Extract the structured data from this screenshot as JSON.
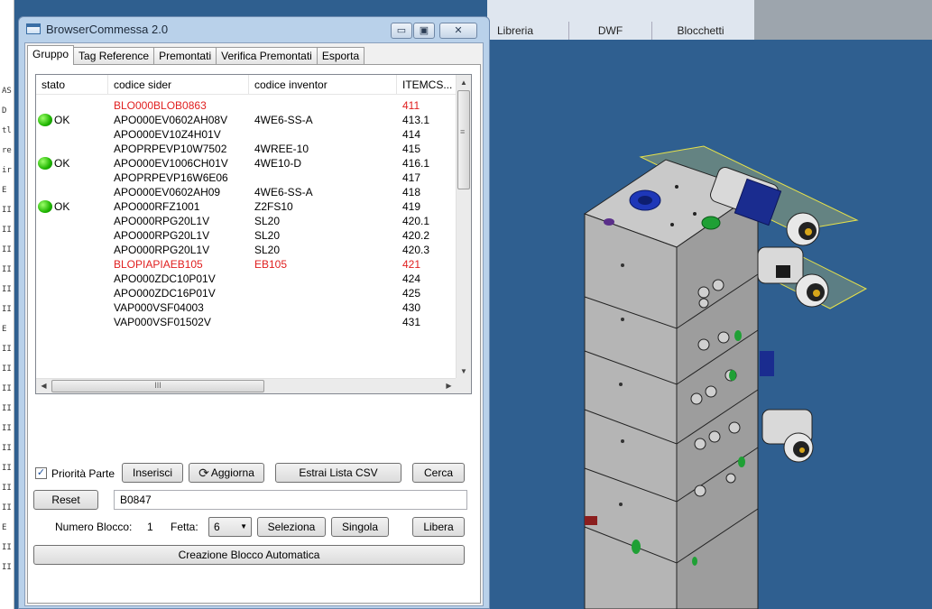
{
  "host": {
    "tabs": [
      "Libreria",
      "DWF",
      "Blocchetti"
    ]
  },
  "left_strip_marks": [
    "AS",
    "D",
    "tl",
    "re",
    "ir",
    "E",
    "II",
    "II",
    "II",
    "II",
    "II",
    "II",
    "E",
    "II",
    "II",
    "II",
    "II",
    "II",
    "II",
    "II",
    "II",
    "II",
    "E",
    "II",
    "II"
  ],
  "window": {
    "title": "BrowserCommessa 2.0",
    "min_glyph": "▭",
    "max_glyph": "▣",
    "close_glyph": "✕",
    "tabs": [
      "Gruppo",
      "Tag Reference",
      "Premontati",
      "Verifica Premontati",
      "Esporta"
    ],
    "active_tab": "Gruppo"
  },
  "list": {
    "columns": [
      "stato",
      "codice sider",
      "codice inventor",
      "ITEMCS..."
    ],
    "rows": [
      {
        "stato": "",
        "sider": "BLO000BLOB0863",
        "inventor": "",
        "item": "411",
        "red": true
      },
      {
        "stato": "OK",
        "sider": "APO000EV0602AH08V",
        "inventor": "4WE6-SS-A",
        "item": "413.1",
        "red": false
      },
      {
        "stato": "",
        "sider": "APO000EV10Z4H01V",
        "inventor": "",
        "item": "414",
        "red": false
      },
      {
        "stato": "",
        "sider": "APOPRPEVP10W7502",
        "inventor": "4WREE-10",
        "item": "415",
        "red": false
      },
      {
        "stato": "OK",
        "sider": "APO000EV1006CH01V",
        "inventor": "4WE10-D",
        "item": "416.1",
        "red": false
      },
      {
        "stato": "",
        "sider": "APOPRPEVP16W6E06",
        "inventor": "",
        "item": "417",
        "red": false
      },
      {
        "stato": "",
        "sider": "APO000EV0602AH09",
        "inventor": "4WE6-SS-A",
        "item": "418",
        "red": false
      },
      {
        "stato": "OK",
        "sider": "APO000RFZ1001",
        "inventor": "Z2FS10",
        "item": "419",
        "red": false
      },
      {
        "stato": "",
        "sider": "APO000RPG20L1V",
        "inventor": "SL20",
        "item": "420.1",
        "red": false
      },
      {
        "stato": "",
        "sider": "APO000RPG20L1V",
        "inventor": "SL20",
        "item": "420.2",
        "red": false
      },
      {
        "stato": "",
        "sider": "APO000RPG20L1V",
        "inventor": "SL20",
        "item": "420.3",
        "red": false
      },
      {
        "stato": "",
        "sider": "BLOPIAPIAEB105",
        "inventor": "EB105",
        "item": "421",
        "red": true
      },
      {
        "stato": "",
        "sider": "APO000ZDC10P01V",
        "inventor": "",
        "item": "424",
        "red": false
      },
      {
        "stato": "",
        "sider": "APO000ZDC16P01V",
        "inventor": "",
        "item": "425",
        "red": false
      },
      {
        "stato": "",
        "sider": "VAP000VSF04003",
        "inventor": "",
        "item": "430",
        "red": false
      },
      {
        "stato": "",
        "sider": "VAP000VSF01502V",
        "inventor": "",
        "item": "431",
        "red": false
      }
    ],
    "hscroll_thumb_glyph": "III"
  },
  "controls": {
    "priorita_label": "Priorità Parte",
    "priorita_checked": true,
    "inserisci": "Inserisci",
    "aggiorna": "Aggiorna",
    "estrai": "Estrai Lista CSV",
    "cerca": "Cerca",
    "reset": "Reset",
    "search_value": "B0847",
    "numero_blocco_label": "Numero Blocco:",
    "numero_blocco_value": "1",
    "fetta_label": "Fetta:",
    "fetta_value": "6",
    "seleziona": "Seleziona",
    "singola": "Singola",
    "libera": "Libera",
    "creazione": "Creazione Blocco Automatica"
  },
  "colors": {
    "viewport_bg": "#2f5f90",
    "red_text": "#e02020",
    "ok_green": "#1fb500"
  }
}
